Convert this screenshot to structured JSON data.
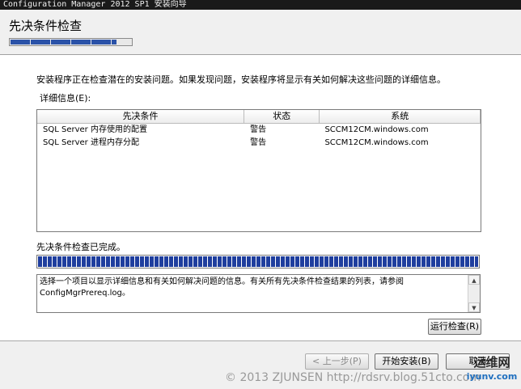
{
  "window": {
    "title": "Configuration Manager 2012 SP1 安装向导"
  },
  "header": {
    "title": "先决条件检查",
    "step_progress": 0.8
  },
  "intro_text": "安装程序正在检查潜在的安装问题。如果发现问题，安装程序将显示有关如何解决这些问题的详细信息。",
  "details_label": "详细信息(E):",
  "table": {
    "columns": [
      "先决条件",
      "状态",
      "系统"
    ],
    "rows": [
      {
        "prerequisite": "SQL Server 内存使用的配置",
        "status": "警告",
        "system": "SCCM12CM.windows.com"
      },
      {
        "prerequisite": "SQL Server 进程内存分配",
        "status": "警告",
        "system": "SCCM12CM.windows.com"
      }
    ]
  },
  "done_label": "先决条件检查已完成。",
  "progress": {
    "value": 1.0
  },
  "info_text": "选择一个项目以显示详细信息和有关如何解决问题的信息。有关所有先决条件检查结果的列表，请参阅 ConfigMgrPrereq.log。",
  "buttons": {
    "run_check": "运行检查(R)",
    "back": "< 上一步(P)",
    "start_install": "开始安装(B)",
    "cancel": "取消"
  },
  "watermark": "© 2013 ZJUNSEN http://rdsrv.blog.51cto.com",
  "logo": {
    "main": "运维网",
    "sub": "iyunv.com"
  }
}
